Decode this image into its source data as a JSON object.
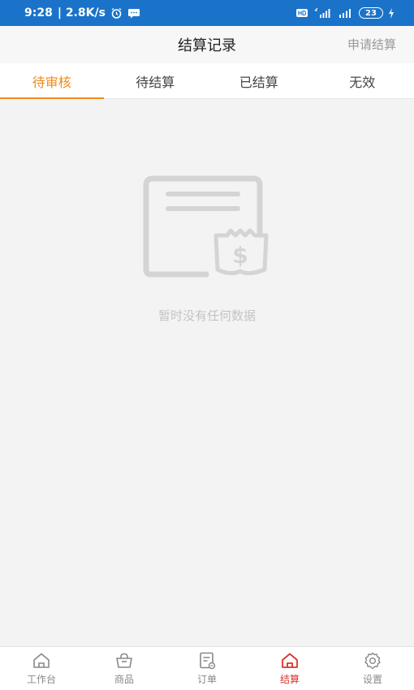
{
  "status_bar": {
    "time": "9:28",
    "speed": "| 2.8K/s",
    "battery": "23"
  },
  "header": {
    "title": "结算记录",
    "action": "申请结算"
  },
  "tabs": [
    {
      "label": "待审核",
      "active": true
    },
    {
      "label": "待结算",
      "active": false
    },
    {
      "label": "已结算",
      "active": false
    },
    {
      "label": "无效",
      "active": false
    }
  ],
  "empty_state": {
    "message": "暂时没有任何数据",
    "icon": "empty-document-money-icon"
  },
  "bottom_nav": [
    {
      "label": "工作台",
      "icon": "home-icon",
      "active": false
    },
    {
      "label": "商品",
      "icon": "basket-icon",
      "active": false
    },
    {
      "label": "订单",
      "icon": "order-icon",
      "active": false
    },
    {
      "label": "结算",
      "icon": "settlement-home-icon",
      "active": true
    },
    {
      "label": "设置",
      "icon": "gear-icon",
      "active": false
    }
  ],
  "colors": {
    "status_bar": "#1a73c9",
    "accent": "#f08a1c",
    "active_nav": "#d9342b"
  }
}
